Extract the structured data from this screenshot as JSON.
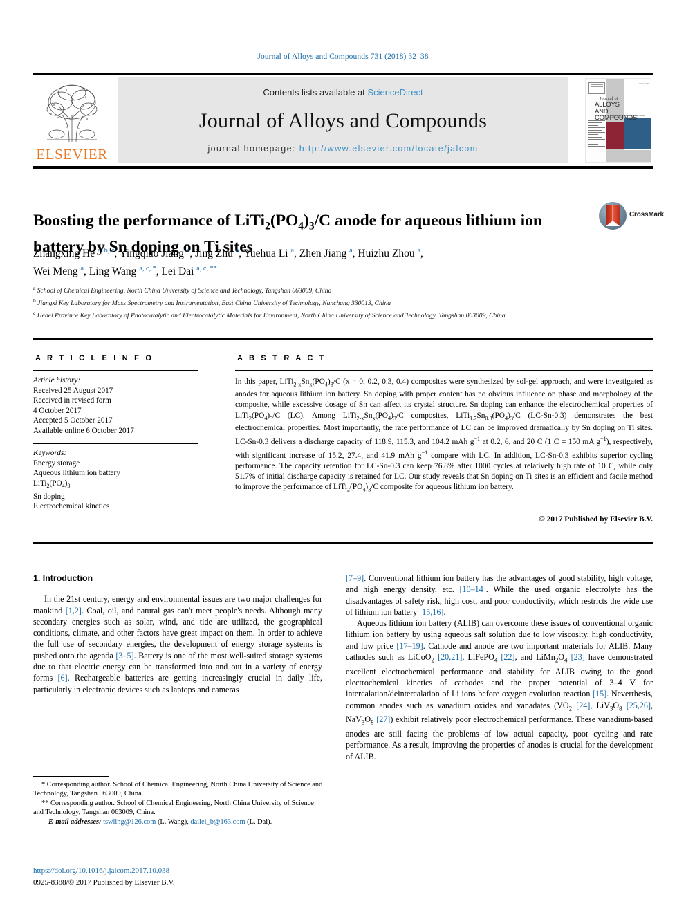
{
  "running_head": "Journal of Alloys and Compounds 731 (2018) 32–38",
  "masthead": {
    "contents_prefix": "Contents lists available at ",
    "sciencedirect": "ScienceDirect",
    "journal_title": "Journal of Alloys and Compounds",
    "homepage_prefix": "journal homepage: ",
    "homepage_url": "http://www.elsevier.com/locate/jalcom",
    "publisher_wordmark": "ELSEVIER",
    "publisher_color": "#E87722",
    "link_color": "#3c8fc4",
    "cover": {
      "line1": "Journal of",
      "line2": "ALLOYS",
      "line3": "AND COMPOUNDS",
      "subtitle": "An Interdisciplinary Journal of Materials Science and Solid-state Chemistry and Physics",
      "corner_note": "Volume 731",
      "red": "#8c2436",
      "blue": "#2e5f88"
    }
  },
  "article": {
    "title_part1": "Boosting the performance of LiTi",
    "title_sub1": "2",
    "title_part2": "(PO",
    "title_sub2": "4",
    "title_part3": ")",
    "title_sub3": "3",
    "title_part4": "/C anode for aqueous lithium ion battery by Sn doping on Ti sites",
    "crossmark_label": "CrossMark",
    "authors_line1": "Zhangxing He a, b, c, Yingqiao Jiang a, Jing Zhu a, Yuehua Li a, Zhen Jiang a, Huizhu Zhou a,",
    "authors_line2": "Wei Meng a, Ling Wang a, c, *, Lei Dai a, c, **",
    "affiliations": [
      {
        "mark": "a",
        "text": "School of Chemical Engineering, North China University of Science and Technology, Tangshan 063009, China"
      },
      {
        "mark": "b",
        "text": "Jiangxi Key Laboratory for Mass Spectrometry and Instrumentation, East China University of Technology, Nanchang 330013, China"
      },
      {
        "mark": "c",
        "text": "Hebei Province Key Laboratory of Photocatalytic and Electrocatalytic Materials for Environment, North China University of Science and Technology, Tangshan 063009, China"
      }
    ]
  },
  "article_info": {
    "heading": "A R T I C L E   I N F O",
    "history_label": "Article history:",
    "history": [
      "Received 25 August 2017",
      "Received in revised form",
      "4 October 2017",
      "Accepted 5 October 2017",
      "Available online 6 October 2017"
    ],
    "keywords_label": "Keywords:",
    "keywords": [
      "Energy storage",
      "Aqueous lithium ion battery",
      "LiTi2(PO4)3",
      "Sn doping",
      "Electrochemical kinetics"
    ]
  },
  "abstract": {
    "heading": "A B S T R A C T",
    "text": "In this paper, LiTi2-xSnx(PO4)3/C (x = 0, 0.2, 0.3, 0.4) composites were synthesized by sol-gel approach, and were investigated as anodes for aqueous lithium ion battery. Sn doping with proper content has no obvious influence on phase and morphology of the composite, while excessive dosage of Sn can affect its crystal structure. Sn doping can enhance the electrochemical properties of LiTi2(PO4)3/C (LC). Among LiTi2-xSnx(PO4)3/C composites, LiTi1.7Sn0.3(PO4)3/C (LC-Sn-0.3) demonstrates the best electrochemical properties. Most importantly, the rate performance of LC can be improved dramatically by Sn doping on Ti sites. LC-Sn-0.3 delivers a discharge capacity of 118.9, 115.3, and 104.2 mAh g−1 at 0.2, 6, and 20 C (1 C = 150 mA g−1), respectively, with significant increase of 15.2, 27.4, and 41.9 mAh g−1 compare with LC. In addition, LC-Sn-0.3 exhibits superior cycling performance. The capacity retention for LC-Sn-0.3 can keep 76.8% after 1000 cycles at relatively high rate of 10 C, while only 51.7% of initial discharge capacity is retained for LC. Our study reveals that Sn doping on Ti sites is an efficient and facile method to improve the performance of LiTi2(PO4)3/C composite for aqueous lithium ion battery.",
    "copyright": "© 2017 Published by Elsevier B.V."
  },
  "body": {
    "section_heading": "1. Introduction",
    "left_paragraph": "In the 21st century, energy and environmental issues are two major challenges for mankind [1,2]. Coal, oil, and natural gas can't meet people's needs. Although many secondary energies such as solar, wind, and tide are utilized, the geographical conditions, climate, and other factors have great impact on them. In order to achieve the full use of secondary energies, the development of energy storage systems is pushed onto the agenda [3–5]. Battery is one of the most well-suited storage systems due to that electric energy can be transformed into and out in a variety of energy forms [6]. Rechargeable batteries are getting increasingly crucial in daily life, particularly in electronic devices such as laptops and cameras",
    "right_paragraph_1": "[7–9]. Conventional lithium ion battery has the advantages of good stability, high voltage, and high energy density, etc. [10–14]. While the used organic electrolyte has the disadvantages of safety risk, high cost, and poor conductivity, which restricts the wide use of lithium ion battery [15,16].",
    "right_paragraph_2": "Aqueous lithium ion battery (ALIB) can overcome these issues of conventional organic lithium ion battery by using aqueous salt solution due to low viscosity, high conductivity, and low price [17–19]. Cathode and anode are two important materials for ALIB. Many cathodes such as LiCoO2 [20,21], LiFePO4 [22], and LiMn2O4 [23] have demonstrated excellent electrochemical performance and stability for ALIB owing to the good electrochemical kinetics of cathodes and the proper potential of 3–4 V for intercalation/deintercalation of Li ions before oxygen evolution reaction [15]. Neverthesis, common anodes such as vanadium oxides and vanadates (VO2 [24], LiV3O8 [25,26], NaV3O8 [27]) exhibit relatively poor electrochemical performance. These vanadium-based anodes are still facing the problems of low actual capacity, poor cycling and rate performance. As a result, improving the properties of anodes is crucial for the development of ALIB."
  },
  "footnotes": {
    "note1": "* Corresponding author. School of Chemical Engineering, North China University of Science and Technology, Tangshan 063009, China.",
    "note2": "** Corresponding author. School of Chemical Engineering, North China University of Science and Technology, Tangshan 063009, China.",
    "email_label": "E-mail addresses:",
    "email1": "tswling@126.com",
    "email1_name": "(L. Wang),",
    "email2": "dailei_b@163.com",
    "email2_name": "(L. Dai).",
    "doi": "https://doi.org/10.1016/j.jalcom.2017.10.038",
    "issn": "0925-8388/© 2017 Published by Elsevier B.V."
  }
}
